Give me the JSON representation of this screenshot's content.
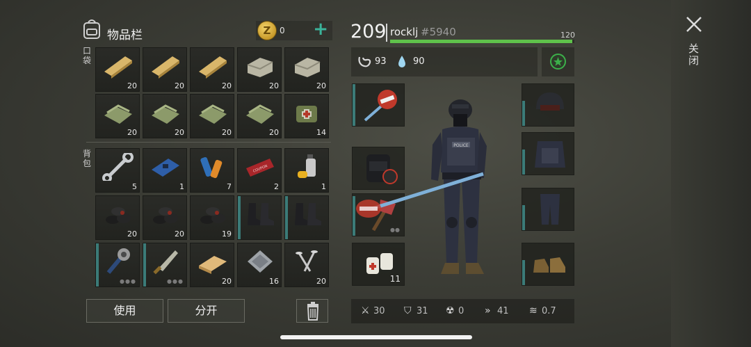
{
  "inventory": {
    "title": "物品栏",
    "coins": "0",
    "pockets_label": "口袋",
    "backpack_label": "背包",
    "pocket_slots": [
      {
        "item": "plank",
        "count": "20"
      },
      {
        "item": "plank",
        "count": "20"
      },
      {
        "item": "plank",
        "count": "20"
      },
      {
        "item": "stone",
        "count": "20"
      },
      {
        "item": "stone",
        "count": "20"
      },
      {
        "item": "cloth",
        "count": "20"
      },
      {
        "item": "cloth",
        "count": "20"
      },
      {
        "item": "cloth",
        "count": "20"
      },
      {
        "item": "cloth",
        "count": "20"
      },
      {
        "item": "medkit-bag",
        "count": "14"
      }
    ],
    "backpack_slots": [
      {
        "item": "wrench",
        "count": "5"
      },
      {
        "item": "circuit-board",
        "count": "1"
      },
      {
        "item": "batteries",
        "count": "7"
      },
      {
        "item": "combat-gear-coupon",
        "count": "2",
        "coupon_text": "COMBAT GEAR COUPON"
      },
      {
        "item": "spray-can",
        "count": "1"
      },
      {
        "item": "coal",
        "count": "20"
      },
      {
        "item": "coal",
        "count": "20"
      },
      {
        "item": "coal",
        "count": "19"
      },
      {
        "item": "boots",
        "count": ""
      },
      {
        "item": "boots",
        "count": ""
      },
      {
        "item": "spiked-club",
        "count": ""
      },
      {
        "item": "machete",
        "count": ""
      },
      {
        "item": "wood-block",
        "count": "20"
      },
      {
        "item": "metal-plate",
        "count": "16"
      },
      {
        "item": "nails",
        "count": "20"
      }
    ],
    "use_button": "使用",
    "split_button": "分开"
  },
  "player": {
    "level": "209",
    "name": "rocklj",
    "id": "#5940",
    "xp_max": "120",
    "xp_fraction": 0.99,
    "food": "93",
    "water": "90"
  },
  "equipment": {
    "left": [
      {
        "item": "stop-sign-weapon",
        "count": ""
      },
      {
        "item": "backpack",
        "count": ""
      },
      {
        "item": "bloody-axe",
        "count": ""
      },
      {
        "item": "bandages",
        "count": "11"
      }
    ],
    "right": [
      {
        "item": "helmet"
      },
      {
        "item": "police-vest"
      },
      {
        "item": "tactical-pants"
      },
      {
        "item": "work-boots"
      }
    ]
  },
  "defense": {
    "attack": "30",
    "armor": "31",
    "radiation": "0",
    "speed": "41",
    "stealth": "0.7"
  },
  "close_label": "关闭",
  "colors": {
    "accent_teal": "#3bb39a",
    "xp_green": "#5fc24b",
    "slot_bar": "#3b7b78"
  }
}
